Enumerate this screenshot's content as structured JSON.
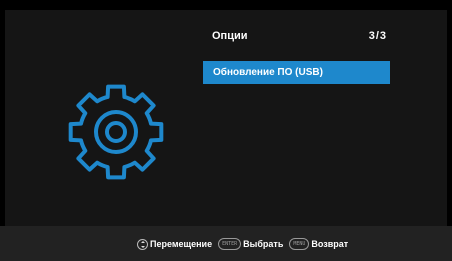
{
  "menu": {
    "title": "Опции",
    "page_indicator": "3/3",
    "items": [
      {
        "label": "Обновление ПО (USB)",
        "selected": true
      }
    ]
  },
  "footer": {
    "hints": [
      {
        "icon": "nav-arrows-icon",
        "label": "Перемещение"
      },
      {
        "key": "ENTER",
        "label": "Выбрать"
      },
      {
        "key": "MENU",
        "label": "Возврат"
      }
    ]
  },
  "colors": {
    "background": "#000000",
    "panel": "#151515",
    "footer": "#222222",
    "highlight": "#1e88cc",
    "gear": "#1e88cc"
  },
  "icons": {
    "main": "gear-icon"
  }
}
